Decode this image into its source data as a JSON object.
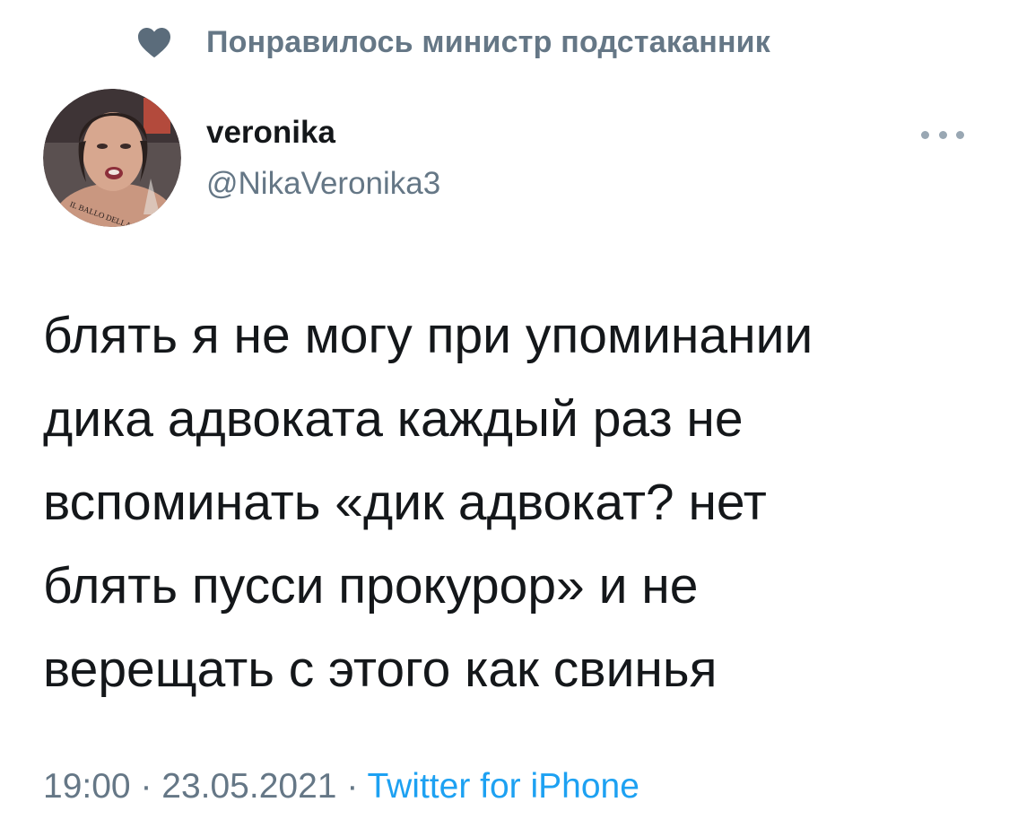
{
  "liked_banner": {
    "icon": "heart-icon",
    "text": "Понравилось министр подстаканник"
  },
  "author": {
    "avatar": "avatar",
    "name": "veronika",
    "handle": "@NikaVeronika3"
  },
  "more_menu": {
    "icon": "more-dots-icon"
  },
  "tweet": {
    "lines": [
      "блять я не могу при упоминании",
      "дика адвоката каждый раз не",
      "вспоминать «дик адвокат? нет",
      "блять пусси прокурор» и не",
      "верещать с этого как свинья"
    ]
  },
  "meta": {
    "time": "19:00",
    "separator": " · ",
    "date": "23.05.2021",
    "source": "Twitter for iPhone"
  },
  "colors": {
    "text_primary": "#14171a",
    "text_secondary": "#657786",
    "link": "#1da1f2",
    "heart": "#5b6c7b"
  }
}
